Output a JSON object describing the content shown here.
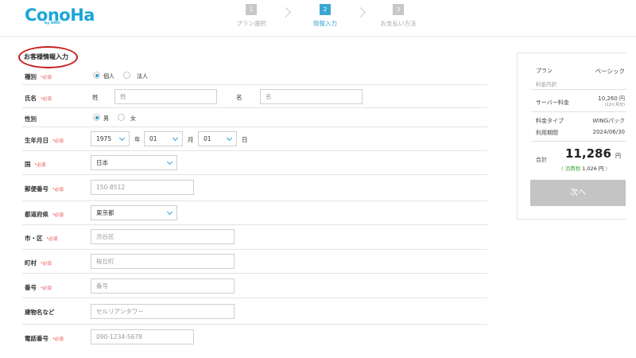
{
  "brand": {
    "logo": "ConoHa",
    "logo_sub": "by GMO"
  },
  "steps": [
    {
      "num": "1",
      "label": "プラン選択"
    },
    {
      "num": "2",
      "label": "情報入力"
    },
    {
      "num": "3",
      "label": "お支払い方法"
    }
  ],
  "form": {
    "section_title": "お客様情報入力",
    "required_mark": "*必須",
    "type": {
      "label": "種別",
      "options": [
        "個人",
        "法人"
      ],
      "selected": "個人"
    },
    "name": {
      "label": "氏名",
      "last_label": "姓",
      "last_placeholder": "姓",
      "first_label": "名",
      "first_placeholder": "名"
    },
    "gender": {
      "label": "性別",
      "options": [
        "男",
        "女"
      ],
      "selected": "男"
    },
    "birthdate": {
      "label": "生年月日",
      "year": "1975",
      "year_unit": "年",
      "month": "01",
      "month_unit": "月",
      "day": "01",
      "day_unit": "日"
    },
    "country": {
      "label": "国",
      "value": "日本"
    },
    "postal": {
      "label": "郵便番号",
      "placeholder": "150-8512"
    },
    "prefecture": {
      "label": "都道府県",
      "value": "東京都"
    },
    "city": {
      "label": "市・区",
      "placeholder": "渋谷区"
    },
    "town": {
      "label": "町村",
      "placeholder": "桜丘町"
    },
    "address_number": {
      "label": "番号",
      "placeholder": "番号"
    },
    "building": {
      "label": "建物名など",
      "placeholder": "セルリアンタワー"
    },
    "phone": {
      "label": "電話番号",
      "placeholder": "090-1234-5678"
    }
  },
  "summary": {
    "plan_label": "プラン",
    "plan_value": "ベーシック",
    "details_label": "料金内訳",
    "server_fee_label": "サーバー料金",
    "server_fee_value": "10,260 円",
    "server_fee_note": "(12ヶ月分)",
    "pricing_type_label": "料金タイプ",
    "pricing_type_value": "WINGパック",
    "period_label": "利用期間",
    "period_value": "2024/06/30",
    "total_label": "合計",
    "total_value": "11,286",
    "total_unit": "円",
    "tax_prefix": "( 消費税 ",
    "tax_value": "1,026 円",
    "tax_suffix": " )",
    "next_button": "次へ"
  },
  "colors": {
    "brand": "#1ba6d6",
    "step_active": "#3aa7d3",
    "required": "#e54a4a",
    "annotation_circle": "#c81e1e",
    "next_button_disabled": "#c4c4c4"
  }
}
